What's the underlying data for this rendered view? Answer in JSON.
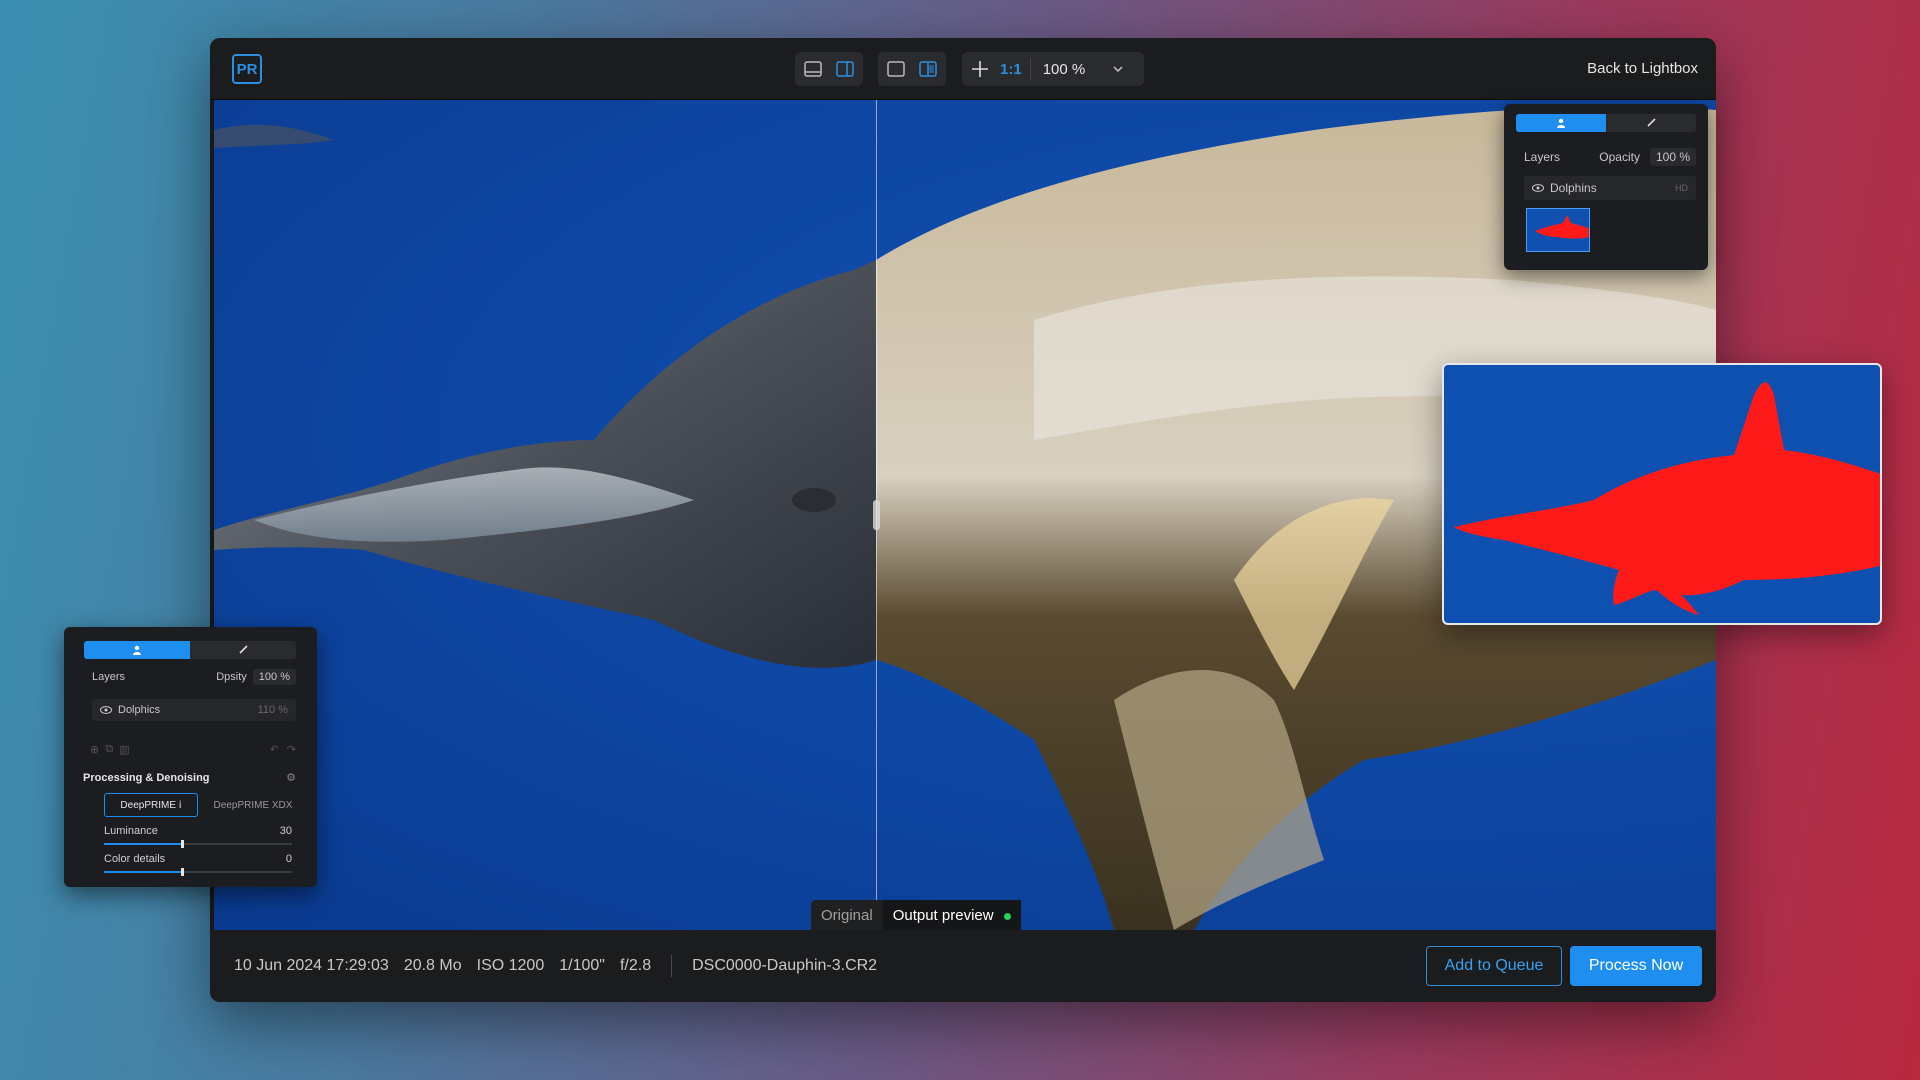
{
  "app": {
    "logo_text": "PR",
    "back_link": "Back to Lightbox",
    "zoom_ratio": "1:1",
    "zoom_value": "100 %"
  },
  "compare": {
    "original_label": "Original",
    "output_label": "Output preview",
    "output_status_color": "#27d15a"
  },
  "metadata": {
    "date": "10 Jun 2024 17:29:03",
    "size": "20.8 Mo",
    "iso": "ISO 1200",
    "shutter": "1/100\"",
    "aperture": "f/2.8",
    "filename": "DSC0000-Dauphin-3.CR2"
  },
  "actions": {
    "add_to_queue": "Add to Queue",
    "process_now": "Process Now"
  },
  "layers_panel": {
    "title": "Layers",
    "opacity_label": "Opacity",
    "opacity_value": "100 %",
    "layer_name": "Dolphins",
    "layer_value": "HD"
  },
  "processing_panel": {
    "layers_title": "Layers",
    "opacity_label": "Dpsity",
    "opacity_value": "100 %",
    "layer_name": "Dolphics",
    "layer_value": "110 %",
    "section_title": "Processing & Denoising",
    "mode_active": "DeepPRIME ⅰ",
    "mode_other": "DeepPRIME XDX",
    "luminance_label": "Luminance",
    "luminance_value": "30",
    "luminance_fraction": 0.41,
    "color_label": "Color details",
    "color_value": "0",
    "color_fraction": 0.41
  },
  "colors": {
    "accent": "#1e8ff0",
    "mask": "#ff1a1a",
    "water": "#0e4ea8"
  }
}
